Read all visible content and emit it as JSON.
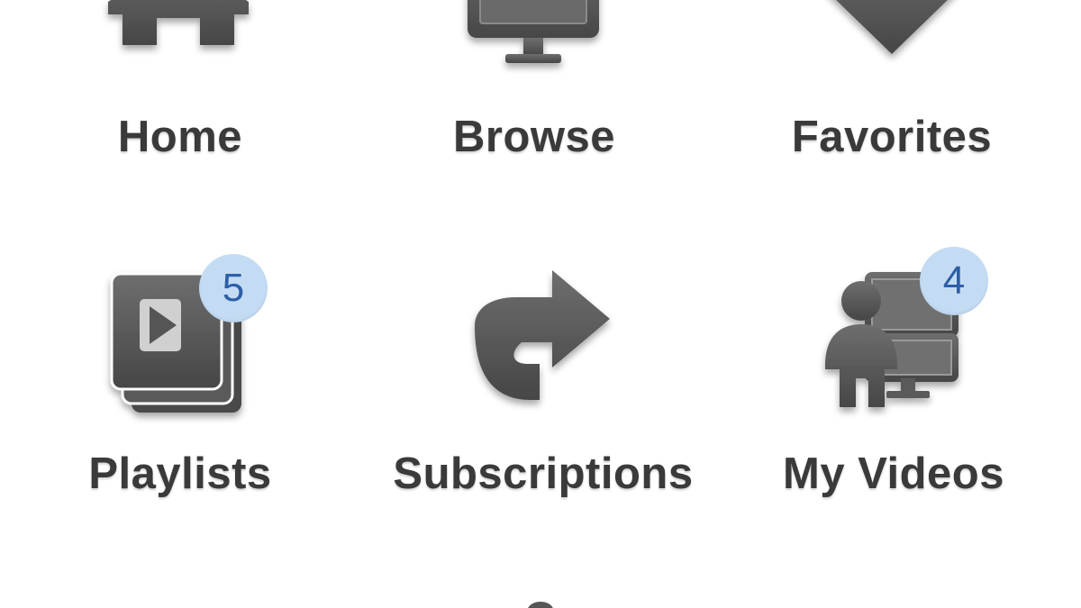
{
  "menu": {
    "items": [
      {
        "id": "home",
        "label": "Home",
        "icon": "house-icon"
      },
      {
        "id": "browse",
        "label": "Browse",
        "icon": "monitor-icon"
      },
      {
        "id": "favorites",
        "label": "Favorites",
        "icon": "heart-icon"
      },
      {
        "id": "playlists",
        "label": "Playlists",
        "icon": "playlist-stack-icon",
        "badge": "5"
      },
      {
        "id": "subscriptions",
        "label": "Subscriptions",
        "icon": "share-arrow-icon"
      },
      {
        "id": "my_videos",
        "label": "My Videos",
        "icon": "user-videos-icon",
        "badge": "4"
      }
    ]
  },
  "colors": {
    "icon_fill": "#555555",
    "label_text": "#3a3a3a",
    "badge_background": "#c4dcf3",
    "badge_text": "#2d5fa8",
    "background": "#ffffff"
  }
}
